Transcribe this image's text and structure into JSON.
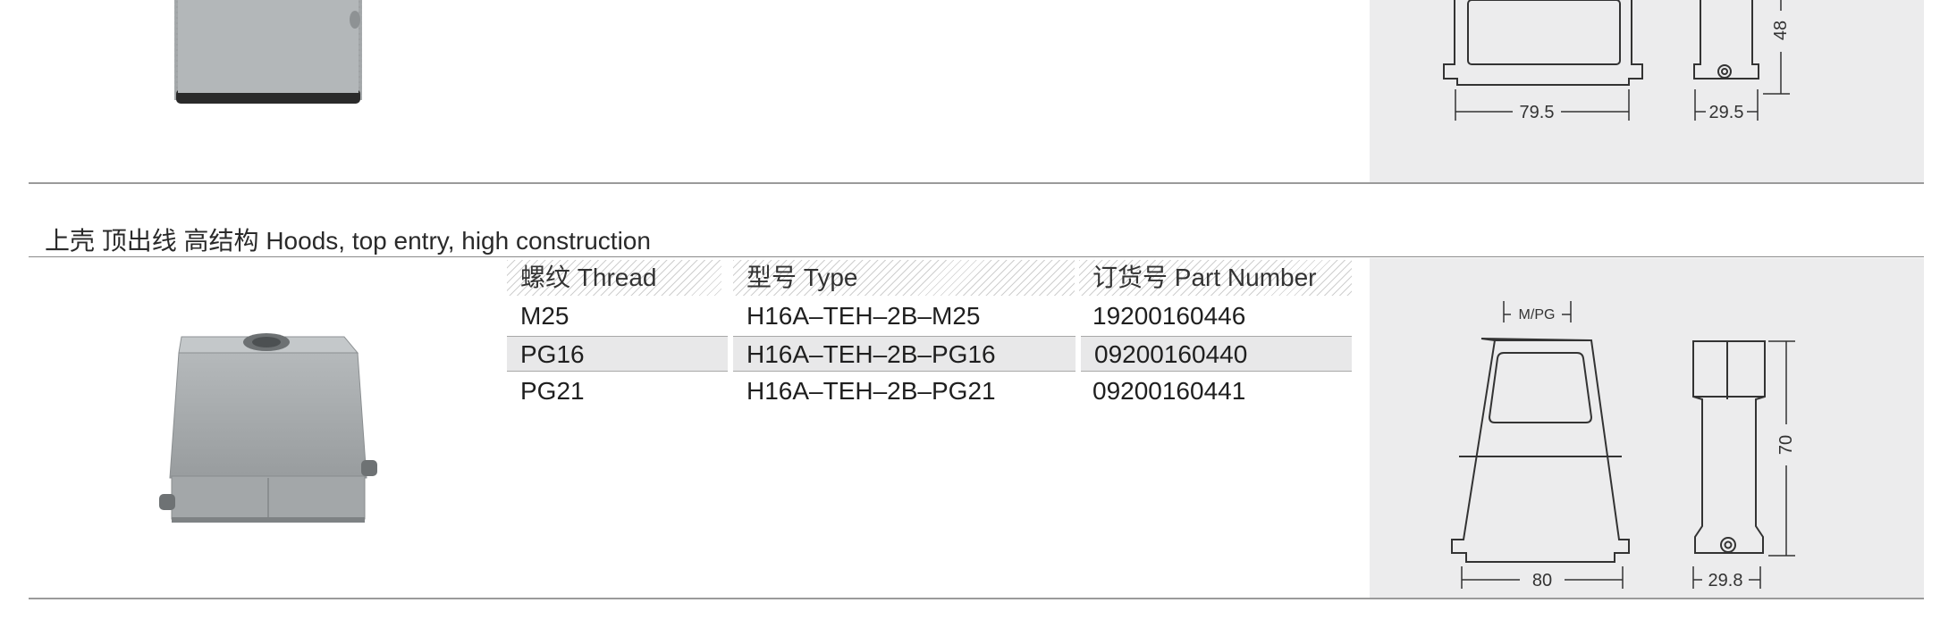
{
  "top_drawing": {
    "dim_width_front": "79.5",
    "dim_width_side": "29.5",
    "dim_height": "48"
  },
  "section": {
    "title": "上壳 顶出线  高结构 Hoods, top entry, high construction",
    "table": {
      "headers": {
        "thread": "螺纹 Thread",
        "type": "型号 Type",
        "part_number": "订货号 Part Number"
      },
      "rows": [
        {
          "thread": "M25",
          "type": "H16A–TEH–2B–M25",
          "part_number": "19200160446",
          "shaded": false
        },
        {
          "thread": "PG16",
          "type": "H16A–TEH–2B–PG16",
          "part_number": "09200160440",
          "shaded": true
        },
        {
          "thread": "PG21",
          "type": "H16A–TEH–2B–PG21",
          "part_number": "09200160441",
          "shaded": false
        }
      ]
    },
    "drawing": {
      "dim_entry": "M/PG",
      "dim_width_front": "80",
      "dim_width_side": "29.8",
      "dim_height": "70"
    }
  },
  "colors": {
    "panel": "#ececed",
    "rule": "#9a9a9a",
    "product_gray": "#a6aaac"
  }
}
